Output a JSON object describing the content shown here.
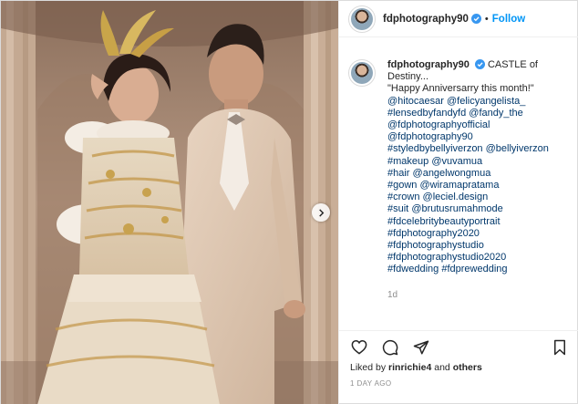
{
  "post": {
    "username": "fdphotography90",
    "follow_label": "Follow",
    "separator": "•",
    "caption_lines": [
      "CASTLE of",
      "Destiny...",
      "\"Happy Anniversarry this month!\"",
      "@hitocaesar @felicyangelista_",
      "#lensedbyfandyfd @fandy_the",
      "@fdphotographyofficial",
      "@fdphotography90",
      "#styledbybellyiverzon @bellyiverzon",
      "#makeup @vuvamua",
      "#hair @angelwongmua",
      "#gown @wiramapratama",
      "#crown @leciel.design",
      "#suit @brutusrumahmode",
      "#fdcelebritybeautyportrait",
      "#fdphotography2020",
      "#fdphotographystudio",
      "#fdphotographystudio2020",
      "#fdwedding #fdprewedding"
    ],
    "comment_age": "1d",
    "likes_prefix": "Liked by",
    "likes_user": "rinrichie4",
    "likes_suffix": "and",
    "likes_others": "others",
    "date": "1 DAY AGO"
  },
  "icons": {
    "like": "heart-icon",
    "comment": "comment-icon",
    "share": "share-icon",
    "save": "bookmark-icon",
    "verified": "verified-badge-icon",
    "carousel_next": "chevron-right-icon"
  },
  "colors": {
    "link": "#00376b",
    "follow": "#0095f6",
    "verified": "#3897f0",
    "muted": "#8e8e8e"
  }
}
